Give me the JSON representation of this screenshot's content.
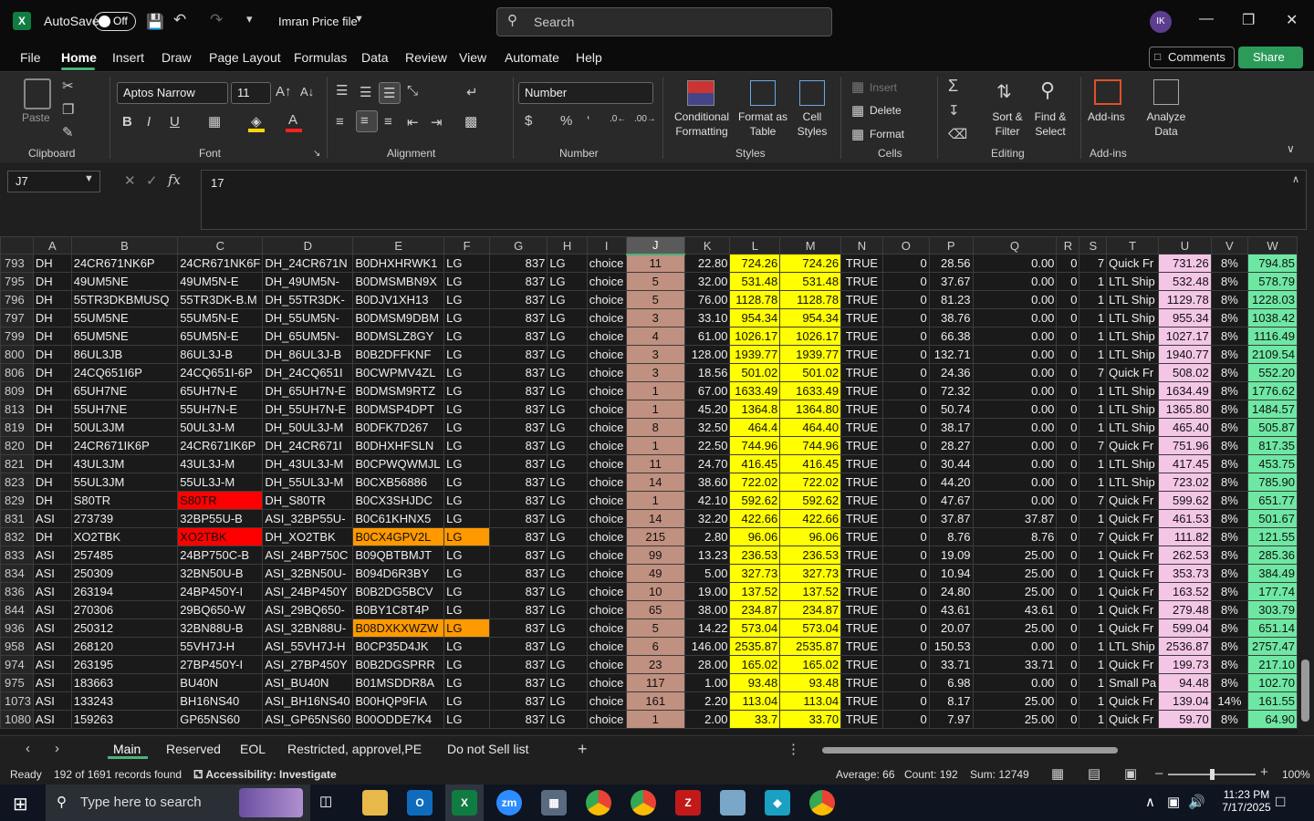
{
  "titlebar": {
    "autosave_label": "AutoSave",
    "autosave_state": "Off",
    "file_name": "Imran Price file",
    "search_placeholder": "Search",
    "avatar_initials": "IK"
  },
  "menu": [
    "File",
    "Home",
    "Insert",
    "Draw",
    "Page Layout",
    "Formulas",
    "Data",
    "Review",
    "View",
    "Automate",
    "Help"
  ],
  "menu_active": "Home",
  "comments_label": "Comments",
  "share_label": "Share",
  "ribbon": {
    "paste": "Paste",
    "font_name": "Aptos Narrow",
    "font_size": "11",
    "number_format": "Number",
    "insert": "Insert",
    "delete": "Delete",
    "format": "Format",
    "conditional_formatting": [
      "Conditional",
      "Formatting"
    ],
    "format_as_table": [
      "Format as",
      "Table"
    ],
    "cell_styles": [
      "Cell",
      "Styles"
    ],
    "sort_filter": [
      "Sort &",
      "Filter"
    ],
    "find_select": [
      "Find &",
      "Select"
    ],
    "addins": "Add-ins",
    "analyze_data": [
      "Analyze",
      "Data"
    ],
    "groups": {
      "clipboard": "Clipboard",
      "font": "Font",
      "alignment": "Alignment",
      "number": "Number",
      "styles": "Styles",
      "cells": "Cells",
      "editing": "Editing",
      "addins": "Add-ins"
    }
  },
  "formula_bar": {
    "name_box": "J7",
    "formula": "17"
  },
  "columns": [
    "A",
    "B",
    "C",
    "D",
    "E",
    "F",
    "G",
    "H",
    "I",
    "J",
    "K",
    "L",
    "M",
    "N",
    "O",
    "P",
    "Q",
    "R",
    "S",
    "T",
    "U",
    "V",
    "W"
  ],
  "selected_column": "J",
  "rows": [
    {
      "r": "793",
      "c": [
        "DH",
        "24CR671NK6P",
        "24CR671NK6F",
        "DH_24CR671N",
        "B0DHXHRWK1",
        "LG",
        "837",
        "LG",
        "choice",
        "11",
        "22.80",
        "724.26",
        "724.26",
        "TRUE",
        "0",
        "28.56",
        "0.00",
        "0",
        "7",
        "Quick Fr",
        "731.26",
        "8%",
        "794.85"
      ]
    },
    {
      "r": "795",
      "c": [
        "DH",
        "49UM5NE",
        "49UM5N-E",
        "DH_49UM5N-",
        "B0DMSMBN9X",
        "LG",
        "837",
        "LG",
        "choice",
        "5",
        "32.00",
        "531.48",
        "531.48",
        "TRUE",
        "0",
        "37.67",
        "0.00",
        "0",
        "1",
        "LTL Ship",
        "532.48",
        "8%",
        "578.79"
      ]
    },
    {
      "r": "796",
      "c": [
        "DH",
        "55TR3DKBMUSQ",
        "55TR3DK-B.M",
        "DH_55TR3DK-",
        "B0DJV1XH13",
        "LG",
        "837",
        "LG",
        "choice",
        "5",
        "76.00",
        "1128.78",
        "1128.78",
        "TRUE",
        "0",
        "81.23",
        "0.00",
        "0",
        "1",
        "LTL Ship",
        "1129.78",
        "8%",
        "1228.03"
      ]
    },
    {
      "r": "797",
      "c": [
        "DH",
        "55UM5NE",
        "55UM5N-E",
        "DH_55UM5N-",
        "B0DMSM9DBM",
        "LG",
        "837",
        "LG",
        "choice",
        "3",
        "33.10",
        "954.34",
        "954.34",
        "TRUE",
        "0",
        "38.76",
        "0.00",
        "0",
        "1",
        "LTL Ship",
        "955.34",
        "8%",
        "1038.42"
      ]
    },
    {
      "r": "799",
      "c": [
        "DH",
        "65UM5NE",
        "65UM5N-E",
        "DH_65UM5N-",
        "B0DMSLZ8GY",
        "LG",
        "837",
        "LG",
        "choice",
        "4",
        "61.00",
        "1026.17",
        "1026.17",
        "TRUE",
        "0",
        "66.38",
        "0.00",
        "0",
        "1",
        "LTL Ship",
        "1027.17",
        "8%",
        "1116.49"
      ]
    },
    {
      "r": "800",
      "c": [
        "DH",
        "86UL3JB",
        "86UL3J-B",
        "DH_86UL3J-B",
        "B0B2DFFKNF",
        "LG",
        "837",
        "LG",
        "choice",
        "3",
        "128.00",
        "1939.77",
        "1939.77",
        "TRUE",
        "0",
        "132.71",
        "0.00",
        "0",
        "1",
        "LTL Ship",
        "1940.77",
        "8%",
        "2109.54"
      ]
    },
    {
      "r": "806",
      "c": [
        "DH",
        "24CQ651I6P",
        "24CQ651I-6P",
        "DH_24CQ651I",
        "B0CWPMV4ZL",
        "LG",
        "837",
        "LG",
        "choice",
        "3",
        "18.56",
        "501.02",
        "501.02",
        "TRUE",
        "0",
        "24.36",
        "0.00",
        "0",
        "7",
        "Quick Fr",
        "508.02",
        "8%",
        "552.20"
      ]
    },
    {
      "r": "809",
      "c": [
        "DH",
        "65UH7NE",
        "65UH7N-E",
        "DH_65UH7N-E",
        "B0DMSM9RTZ",
        "LG",
        "837",
        "LG",
        "choice",
        "1",
        "67.00",
        "1633.49",
        "1633.49",
        "TRUE",
        "0",
        "72.32",
        "0.00",
        "0",
        "1",
        "LTL Ship",
        "1634.49",
        "8%",
        "1776.62"
      ]
    },
    {
      "r": "813",
      "c": [
        "DH",
        "55UH7NE",
        "55UH7N-E",
        "DH_55UH7N-E",
        "B0DMSP4DPT",
        "LG",
        "837",
        "LG",
        "choice",
        "1",
        "45.20",
        "1364.8",
        "1364.80",
        "TRUE",
        "0",
        "50.74",
        "0.00",
        "0",
        "1",
        "LTL Ship",
        "1365.80",
        "8%",
        "1484.57"
      ]
    },
    {
      "r": "819",
      "c": [
        "DH",
        "50UL3JM",
        "50UL3J-M",
        "DH_50UL3J-M",
        "B0DFK7D267",
        "LG",
        "837",
        "LG",
        "choice",
        "8",
        "32.50",
        "464.4",
        "464.40",
        "TRUE",
        "0",
        "38.17",
        "0.00",
        "0",
        "1",
        "LTL Ship",
        "465.40",
        "8%",
        "505.87"
      ]
    },
    {
      "r": "820",
      "c": [
        "DH",
        "24CR671IK6P",
        "24CR671IK6P",
        "DH_24CR671I",
        "B0DHXHFSLN",
        "LG",
        "837",
        "LG",
        "choice",
        "1",
        "22.50",
        "744.96",
        "744.96",
        "TRUE",
        "0",
        "28.27",
        "0.00",
        "0",
        "7",
        "Quick Fr",
        "751.96",
        "8%",
        "817.35"
      ]
    },
    {
      "r": "821",
      "c": [
        "DH",
        "43UL3JM",
        "43UL3J-M",
        "DH_43UL3J-M",
        "B0CPWQWMJL",
        "LG",
        "837",
        "LG",
        "choice",
        "11",
        "24.70",
        "416.45",
        "416.45",
        "TRUE",
        "0",
        "30.44",
        "0.00",
        "0",
        "1",
        "LTL Ship",
        "417.45",
        "8%",
        "453.75"
      ]
    },
    {
      "r": "823",
      "c": [
        "DH",
        "55UL3JM",
        "55UL3J-M",
        "DH_55UL3J-M",
        "B0CXB56886",
        "LG",
        "837",
        "LG",
        "choice",
        "14",
        "38.60",
        "722.02",
        "722.02",
        "TRUE",
        "0",
        "44.20",
        "0.00",
        "0",
        "1",
        "LTL Ship",
        "723.02",
        "8%",
        "785.90"
      ]
    },
    {
      "r": "829",
      "c": [
        "DH",
        "S80TR",
        "S80TR",
        "DH_S80TR",
        "B0CX3SHJDC",
        "LG",
        "837",
        "LG",
        "choice",
        "1",
        "42.10",
        "592.62",
        "592.62",
        "TRUE",
        "0",
        "47.67",
        "0.00",
        "0",
        "7",
        "Quick Fr",
        "599.62",
        "8%",
        "651.77"
      ]
    },
    {
      "r": "831",
      "c": [
        "ASI",
        "273739",
        "32BP55U-B",
        "ASI_32BP55U-",
        "B0C61KHNX5",
        "LG",
        "837",
        "LG",
        "choice",
        "14",
        "32.20",
        "422.66",
        "422.66",
        "TRUE",
        "0",
        "37.87",
        "37.87",
        "0",
        "1",
        "Quick Fr",
        "461.53",
        "8%",
        "501.67"
      ]
    },
    {
      "r": "832",
      "c": [
        "DH",
        "XO2TBK",
        "XO2TBK",
        "DH_XO2TBK",
        "B0CX4GPV2L",
        "LG",
        "837",
        "LG",
        "choice",
        "215",
        "2.80",
        "96.06",
        "96.06",
        "TRUE",
        "0",
        "8.76",
        "8.76",
        "0",
        "7",
        "Quick Fr",
        "111.82",
        "8%",
        "121.55"
      ]
    },
    {
      "r": "833",
      "c": [
        "ASI",
        "257485",
        "24BP750C-B",
        "ASI_24BP750C",
        "B09QBTBMJT",
        "LG",
        "837",
        "LG",
        "choice",
        "99",
        "13.23",
        "236.53",
        "236.53",
        "TRUE",
        "0",
        "19.09",
        "25.00",
        "0",
        "1",
        "Quick Fr",
        "262.53",
        "8%",
        "285.36"
      ]
    },
    {
      "r": "834",
      "c": [
        "ASI",
        "250309",
        "32BN50U-B",
        "ASI_32BN50U-",
        "B094D6R3BY",
        "LG",
        "837",
        "LG",
        "choice",
        "49",
        "5.00",
        "327.73",
        "327.73",
        "TRUE",
        "0",
        "10.94",
        "25.00",
        "0",
        "1",
        "Quick Fr",
        "353.73",
        "8%",
        "384.49"
      ]
    },
    {
      "r": "836",
      "c": [
        "ASI",
        "263194",
        "24BP450Y-I",
        "ASI_24BP450Y",
        "B0B2DG5BCV",
        "LG",
        "837",
        "LG",
        "choice",
        "10",
        "19.00",
        "137.52",
        "137.52",
        "TRUE",
        "0",
        "24.80",
        "25.00",
        "0",
        "1",
        "Quick Fr",
        "163.52",
        "8%",
        "177.74"
      ]
    },
    {
      "r": "844",
      "c": [
        "ASI",
        "270306",
        "29BQ650-W",
        "ASI_29BQ650-",
        "B0BY1C8T4P",
        "LG",
        "837",
        "LG",
        "choice",
        "65",
        "38.00",
        "234.87",
        "234.87",
        "TRUE",
        "0",
        "43.61",
        "43.61",
        "0",
        "1",
        "Quick Fr",
        "279.48",
        "8%",
        "303.79"
      ]
    },
    {
      "r": "936",
      "c": [
        "ASI",
        "250312",
        "32BN88U-B",
        "ASI_32BN88U-",
        "B08DXKXWZW",
        "LG",
        "837",
        "LG",
        "choice",
        "5",
        "14.22",
        "573.04",
        "573.04",
        "TRUE",
        "0",
        "20.07",
        "25.00",
        "0",
        "1",
        "Quick Fr",
        "599.04",
        "8%",
        "651.14"
      ]
    },
    {
      "r": "958",
      "c": [
        "ASI",
        "268120",
        "55VH7J-H",
        "ASI_55VH7J-H",
        "B0CP35D4JK",
        "LG",
        "837",
        "LG",
        "choice",
        "6",
        "146.00",
        "2535.87",
        "2535.87",
        "TRUE",
        "0",
        "150.53",
        "0.00",
        "0",
        "1",
        "LTL Ship",
        "2536.87",
        "8%",
        "2757.47"
      ]
    },
    {
      "r": "974",
      "c": [
        "ASI",
        "263195",
        "27BP450Y-I",
        "ASI_27BP450Y",
        "B0B2DGSPRR",
        "LG",
        "837",
        "LG",
        "choice",
        "23",
        "28.00",
        "165.02",
        "165.02",
        "TRUE",
        "0",
        "33.71",
        "33.71",
        "0",
        "1",
        "Quick Fr",
        "199.73",
        "8%",
        "217.10"
      ]
    },
    {
      "r": "975",
      "c": [
        "ASI",
        "183663",
        "BU40N",
        "ASI_BU40N",
        "B01MSDDR8A",
        "LG",
        "837",
        "LG",
        "choice",
        "117",
        "1.00",
        "93.48",
        "93.48",
        "TRUE",
        "0",
        "6.98",
        "0.00",
        "0",
        "1",
        "Small Pa",
        "94.48",
        "8%",
        "102.70"
      ]
    },
    {
      "r": "1073",
      "c": [
        "ASI",
        "133243",
        "BH16NS40",
        "ASI_BH16NS40",
        "B00HQP9FIA",
        "LG",
        "837",
        "LG",
        "choice",
        "161",
        "2.20",
        "113.04",
        "113.04",
        "TRUE",
        "0",
        "8.17",
        "25.00",
        "0",
        "1",
        "Quick Fr",
        "139.04",
        "14%",
        "161.55"
      ]
    },
    {
      "r": "1080",
      "c": [
        "ASI",
        "159263",
        "GP65NS60",
        "ASI_GP65NS60",
        "B00ODDE7K4",
        "LG",
        "837",
        "LG",
        "choice",
        "1",
        "2.00",
        "33.7",
        "33.70",
        "TRUE",
        "0",
        "7.97",
        "25.00",
        "0",
        "1",
        "Quick Fr",
        "59.70",
        "8%",
        "64.90"
      ]
    }
  ],
  "highlight_colors": {
    "J": "#c09080",
    "L": "#ffff00",
    "M": "#ffff00",
    "U": "#f3c6e6",
    "W": "#6ee7a3",
    "red": "#ff0000",
    "orange": "#ff9900"
  },
  "sheet_tabs": [
    "Main",
    "Reserved",
    "EOL",
    "Restricted, approvel,PE",
    "Do not Sell list"
  ],
  "active_tab": "Main",
  "status": {
    "ready": "Ready",
    "records": "192 of 1691 records found",
    "accessibility": "Accessibility: Investigate",
    "average": "Average: 66",
    "count": "Count: 192",
    "sum": "Sum: 12749",
    "zoom": "100%"
  },
  "taskbar": {
    "search_placeholder": "Type here to search",
    "time": "11:23 PM",
    "date": "7/17/2025"
  }
}
